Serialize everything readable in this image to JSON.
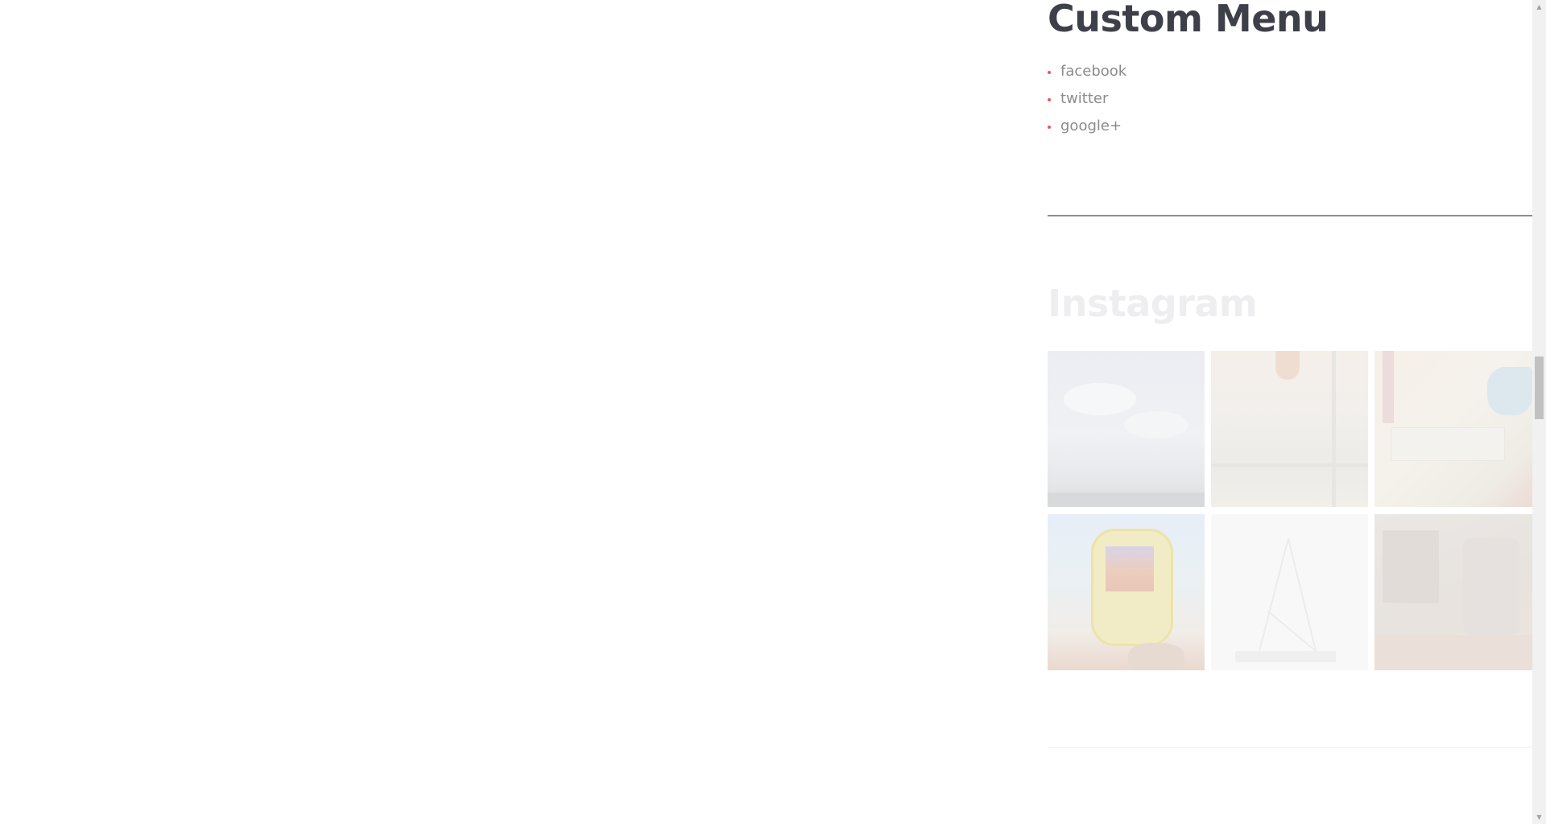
{
  "custom_menu": {
    "title": "Custom Menu",
    "items": [
      {
        "label": "facebook"
      },
      {
        "label": "twitter"
      },
      {
        "label": "google+"
      }
    ],
    "bullet_color": "#e45a5a"
  },
  "instagram": {
    "title": "Instagram",
    "thumbnails": [
      {
        "subject": "cloudy sky"
      },
      {
        "subject": "ceiling with pendant lamp"
      },
      {
        "subject": "room interior"
      },
      {
        "subject": "thermal imaging camera"
      },
      {
        "subject": "minimal stand"
      },
      {
        "subject": "workshop"
      }
    ]
  },
  "colors": {
    "heading": "#3e4049",
    "menu_text": "#8b8b8e",
    "faded_heading": "#eeeef0"
  },
  "scrollbar": {
    "up_icon": "scroll-up-arrow-icon",
    "down_icon": "scroll-down-arrow-icon"
  }
}
